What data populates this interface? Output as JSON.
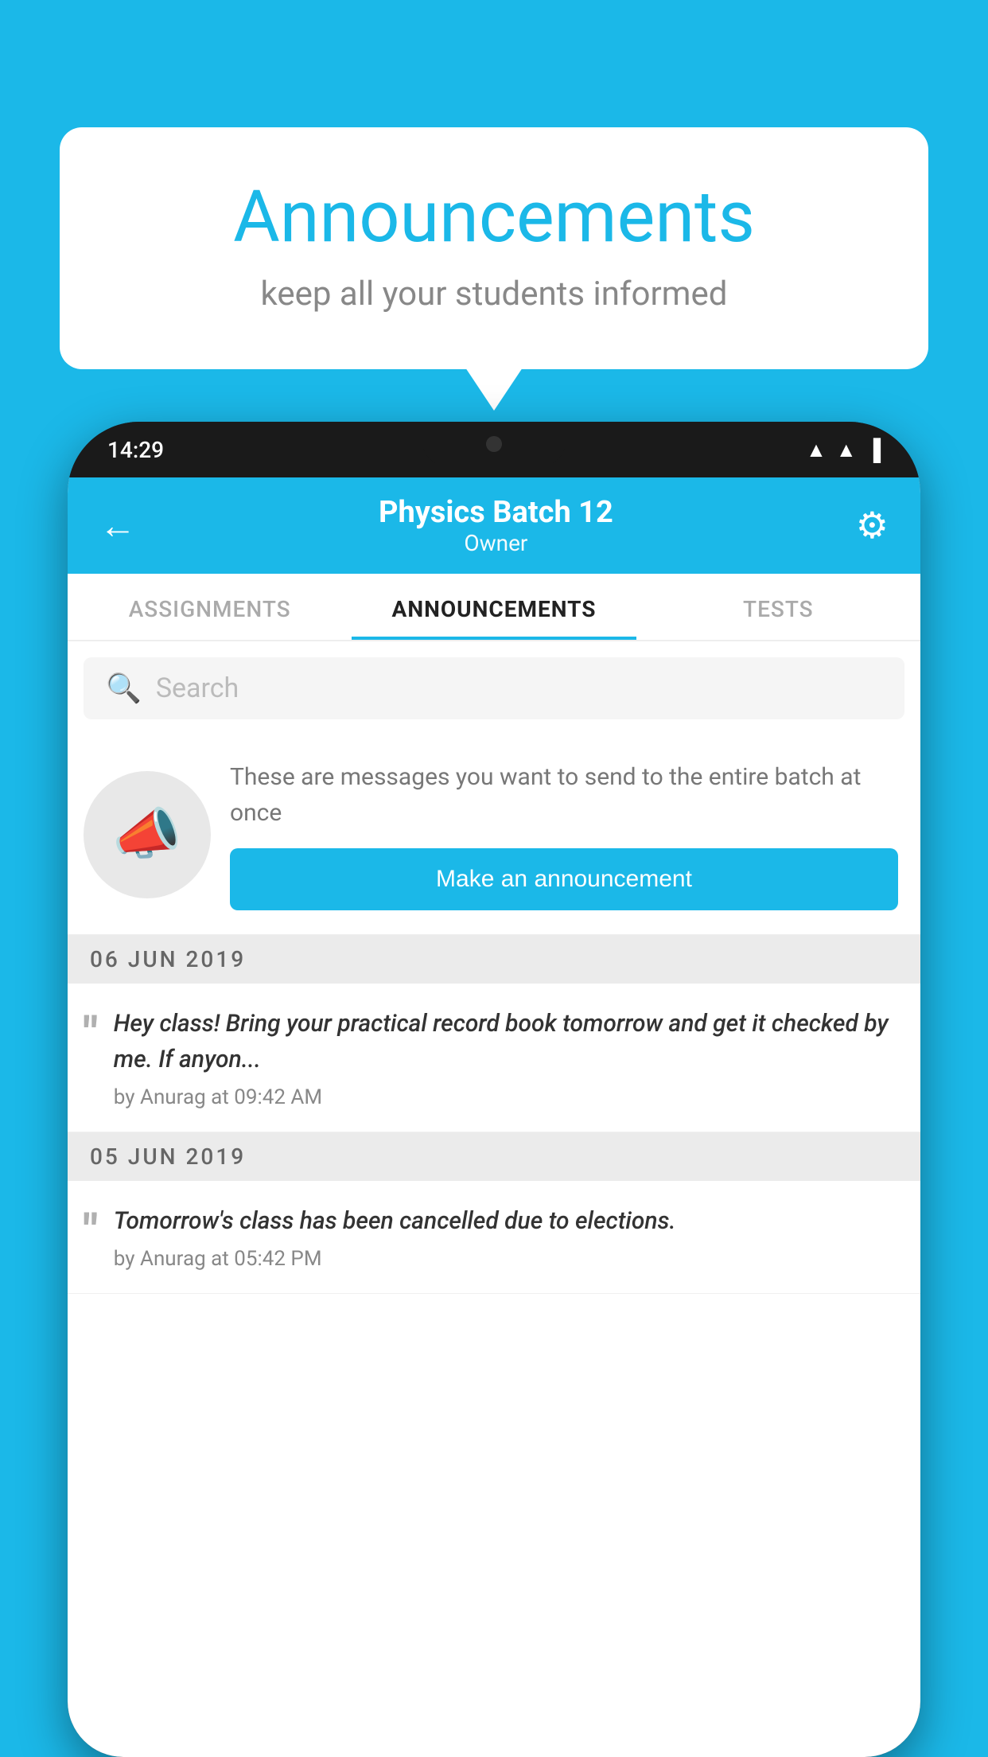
{
  "background_color": "#1bb8e8",
  "speech_bubble": {
    "title": "Announcements",
    "subtitle": "keep all your students informed"
  },
  "phone": {
    "status_bar": {
      "time": "14:29",
      "wifi_icon": "▲",
      "signal_icon": "▲",
      "battery_icon": "▐"
    },
    "header": {
      "back_label": "←",
      "title": "Physics Batch 12",
      "subtitle": "Owner",
      "gear_icon": "⚙"
    },
    "tabs": [
      {
        "label": "ASSIGNMENTS",
        "active": false
      },
      {
        "label": "ANNOUNCEMENTS",
        "active": true
      },
      {
        "label": "TESTS",
        "active": false
      },
      {
        "label": "···",
        "active": false
      }
    ],
    "search": {
      "placeholder": "Search",
      "icon": "🔍"
    },
    "promo": {
      "text": "These are messages you want to send to the entire batch at once",
      "button_label": "Make an announcement"
    },
    "announcements": [
      {
        "date": "06  JUN  2019",
        "message": "Hey class! Bring your practical record book tomorrow and get it checked by me. If anyon...",
        "meta": "by Anurag at 09:42 AM"
      },
      {
        "date": "05  JUN  2019",
        "message": "Tomorrow's class has been cancelled due to elections.",
        "meta": "by Anurag at 05:42 PM"
      }
    ]
  }
}
